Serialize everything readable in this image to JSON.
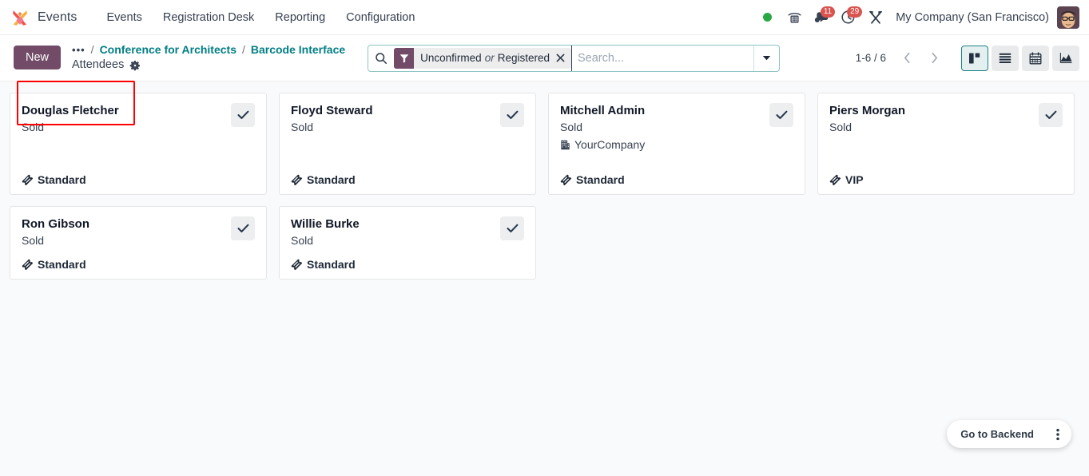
{
  "navbar": {
    "brand": "Events",
    "logo_icon": "events-logo-icon",
    "menu": [
      {
        "label": "Events"
      },
      {
        "label": "Registration Desk"
      },
      {
        "label": "Reporting"
      },
      {
        "label": "Configuration"
      }
    ],
    "systray": {
      "presence_icon": "green-status-dot-icon",
      "voip_icon": "phone-dialpad-icon",
      "messages_icon": "chat-bubble-icon",
      "messages_count": "11",
      "activities_icon": "activity-clock-icon",
      "activities_count": "29",
      "tools_icon": "wrench-tools-icon",
      "company": "My Company (San Francisco)",
      "avatar_icon": "user-avatar-icon"
    },
    "accent_color": "#E46F64"
  },
  "control_panel": {
    "new_label": "New",
    "new_color": "#714B67",
    "breadcrumb": {
      "dots": "•••",
      "separator": "/",
      "links": [
        {
          "label": "Conference for Architects"
        },
        {
          "label": "Barcode Interface"
        }
      ],
      "current": "Attendees",
      "gear_icon": "gear-icon",
      "link_color": "#017E84"
    },
    "search": {
      "search_icon": "search-icon",
      "facet": {
        "filter_icon": "filter-funnel-icon",
        "part_one": "Unconfirmed",
        "joiner": "or",
        "part_two": "Registered",
        "remove_icon": "close-x-icon",
        "icon_bg": "#714B67"
      },
      "placeholder": "Search...",
      "value": "",
      "dropdown_icon": "chevron-down-icon"
    },
    "pager": {
      "value": "1-6 / 6",
      "prev_icon": "chevron-left-icon",
      "next_icon": "chevron-right-icon"
    },
    "views": [
      {
        "name": "kanban",
        "icon": "kanban-view-icon",
        "active": true
      },
      {
        "name": "list",
        "icon": "list-view-icon",
        "active": false
      },
      {
        "name": "calendar",
        "icon": "calendar-view-icon",
        "active": false
      },
      {
        "name": "graph",
        "icon": "graph-view-icon",
        "active": false
      }
    ],
    "active_view_color": "#1C8186"
  },
  "kanban": {
    "cards": [
      {
        "name": "Douglas Fletcher",
        "state": "Sold",
        "company": null,
        "ticket": "Standard",
        "ticket_icon": "ticket-icon",
        "check_icon": "check-icon"
      },
      {
        "name": "Floyd Steward",
        "state": "Sold",
        "company": null,
        "ticket": "Standard",
        "ticket_icon": "ticket-icon",
        "check_icon": "check-icon"
      },
      {
        "name": "Mitchell Admin",
        "state": "Sold",
        "company": "YourCompany",
        "company_icon": "building-icon",
        "ticket": "Standard",
        "ticket_icon": "ticket-icon",
        "check_icon": "check-icon"
      },
      {
        "name": "Piers Morgan",
        "state": "Sold",
        "company": null,
        "ticket": "VIP",
        "ticket_icon": "ticket-icon",
        "check_icon": "check-icon"
      },
      {
        "name": "Ron Gibson",
        "state": "Sold",
        "company": null,
        "ticket": "Standard",
        "ticket_icon": "ticket-icon",
        "check_icon": "check-icon"
      },
      {
        "name": "Willie Burke",
        "state": "Sold",
        "company": null,
        "ticket": "Standard",
        "ticket_icon": "ticket-icon",
        "check_icon": "check-icon"
      }
    ]
  },
  "backend_fab": {
    "label": "Go to Backend",
    "kebab_icon": "vertical-ellipsis-icon"
  }
}
